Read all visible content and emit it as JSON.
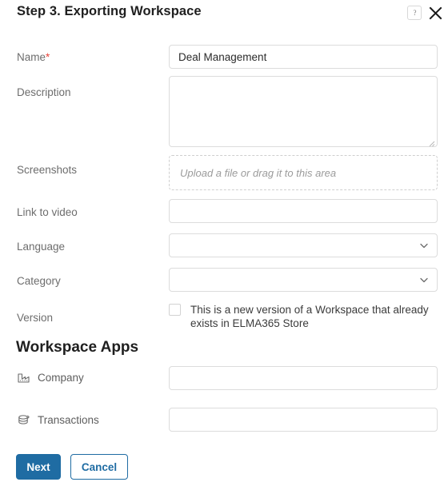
{
  "header": {
    "title": "Step 3. Exporting Workspace",
    "help_icon": "help-question-icon",
    "close_icon": "close-icon"
  },
  "theme": {
    "accent": "#1f6ca3",
    "required": "#e8453c",
    "label": "#6d6d6d",
    "border": "#dcdcdc"
  },
  "form": {
    "fields": [
      {
        "label": "Name",
        "required": true,
        "required_marker": "*",
        "type": "text",
        "value": "Deal Management",
        "placeholder": ""
      },
      {
        "label": "Description",
        "required": false,
        "type": "textarea",
        "value": "",
        "placeholder": ""
      },
      {
        "label": "Screenshots",
        "required": false,
        "type": "upload",
        "hint": "Upload a file or drag it to this area"
      },
      {
        "label": "Link to video",
        "required": false,
        "type": "text",
        "value": "",
        "placeholder": ""
      },
      {
        "label": "Language",
        "required": false,
        "type": "select",
        "value": "",
        "chevron_icon": "chevron-down-icon"
      },
      {
        "label": "Category",
        "required": false,
        "type": "select",
        "value": "",
        "chevron_icon": "chevron-down-icon"
      },
      {
        "label": "Version",
        "required": false,
        "type": "checkbox",
        "checked": false,
        "checkbox_label": "This is a new version of a Workspace that already exists in ELMA365 Store"
      }
    ]
  },
  "apps_section": {
    "heading": "Workspace Apps",
    "apps": [
      {
        "name": "Company",
        "icon": "factory-icon",
        "value": "",
        "placeholder": ""
      },
      {
        "name": "Transactions",
        "icon": "database-stack-icon",
        "value": "",
        "placeholder": ""
      }
    ]
  },
  "footer": {
    "next_label": "Next",
    "cancel_label": "Cancel"
  }
}
